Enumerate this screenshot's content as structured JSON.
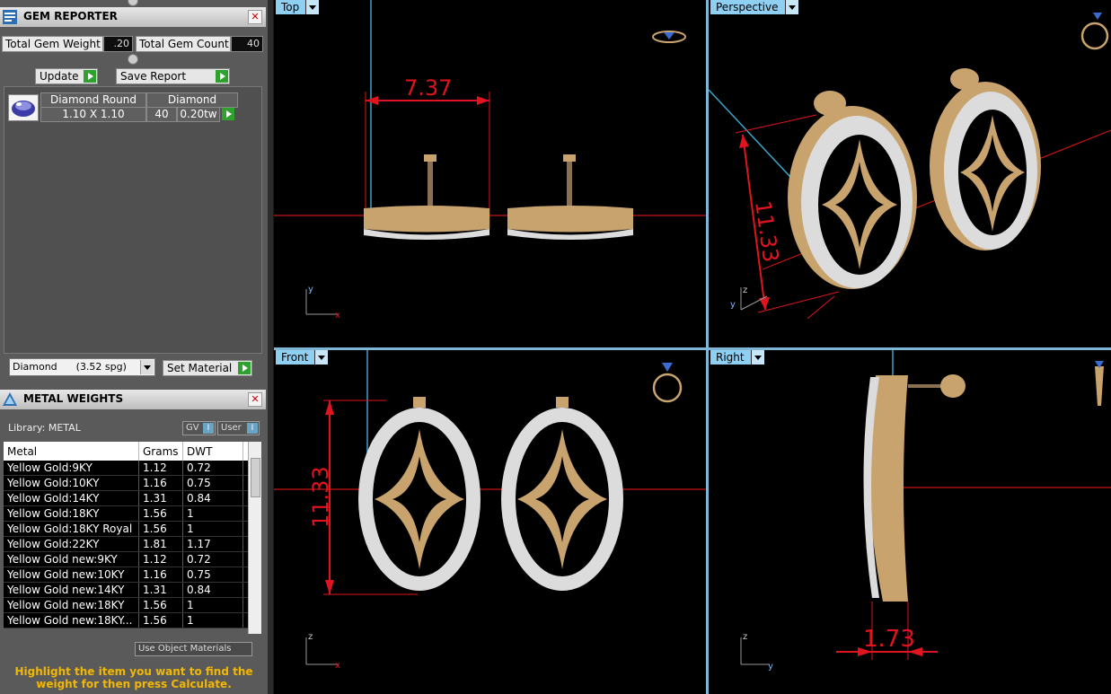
{
  "gem_reporter": {
    "title": "GEM REPORTER",
    "total_weight_label": "Total Gem Weight",
    "total_weight_value": ".20",
    "total_count_label": "Total Gem Count",
    "total_count_value": "40",
    "update_label": "Update",
    "save_report_label": "Save Report",
    "gem_row": {
      "shape_label": "Diamond Round",
      "material_label": "Diamond",
      "size": "1.10 X 1.10",
      "count": "40",
      "weight": "0.20tw"
    },
    "material_select": "Diamond      (3.52 spg)",
    "set_material_label": "Set Material"
  },
  "metal_weights": {
    "title": "METAL WEIGHTS",
    "library_label": "Library: METAL",
    "gv_label": "GV",
    "user_label": "User",
    "columns": [
      "Metal",
      "Grams",
      "DWT"
    ],
    "rows": [
      [
        "Yellow Gold:9KY",
        "1.12",
        "0.72"
      ],
      [
        "Yellow Gold:10KY",
        "1.16",
        "0.75"
      ],
      [
        "Yellow Gold:14KY",
        "1.31",
        "0.84"
      ],
      [
        "Yellow Gold:18KY",
        "1.56",
        "1"
      ],
      [
        "Yellow Gold:18KY Royal",
        "1.56",
        "1"
      ],
      [
        "Yellow Gold:22KY",
        "1.81",
        "1.17"
      ],
      [
        "Yellow Gold new:9KY",
        "1.12",
        "0.72"
      ],
      [
        "Yellow Gold new:10KY",
        "1.16",
        "0.75"
      ],
      [
        "Yellow Gold new:14KY",
        "1.31",
        "0.84"
      ],
      [
        "Yellow Gold new:18KY",
        "1.56",
        "1"
      ],
      [
        "Yellow Gold new:18KY...",
        "1.56",
        "1"
      ]
    ],
    "use_object_materials_label": "Use Object Materials",
    "hint": "Highlight the item you want to find the weight for then press Calculate."
  },
  "viewports": {
    "top": {
      "label": "Top",
      "dimension": "7.37",
      "axis_a": "y",
      "axis_b": "x"
    },
    "perspective": {
      "label": "Perspective",
      "dimension": "11.33",
      "axis_a": "z",
      "axis_b": "y"
    },
    "front": {
      "label": "Front",
      "dimension": "11.33",
      "axis_a": "z",
      "axis_b": "x"
    },
    "right": {
      "label": "Right",
      "dimension": "1.73",
      "axis_a": "z",
      "axis_b": "y"
    }
  },
  "colors": {
    "dimension_red": "#e0141e",
    "gold": "#c8a36e",
    "viewport_tab": "#8fcff2",
    "hint_text": "#f2b705"
  }
}
